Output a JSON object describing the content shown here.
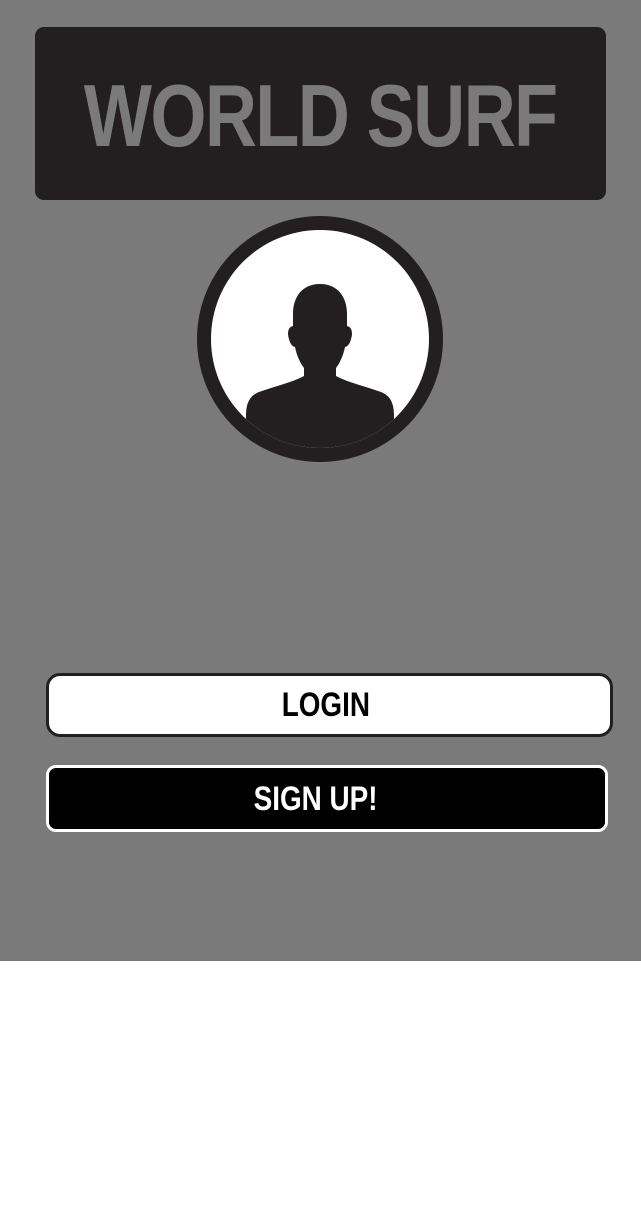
{
  "app": {
    "title": "WORLD SURF"
  },
  "avatar": {
    "icon": "user-silhouette-icon"
  },
  "buttons": {
    "login_label": "LOGIN",
    "signup_label": "SIGN UP!"
  },
  "colors": {
    "screen_background": "#7a7a7a",
    "header_background": "#231f20",
    "login_background": "#ffffff",
    "signup_background": "#000000"
  }
}
